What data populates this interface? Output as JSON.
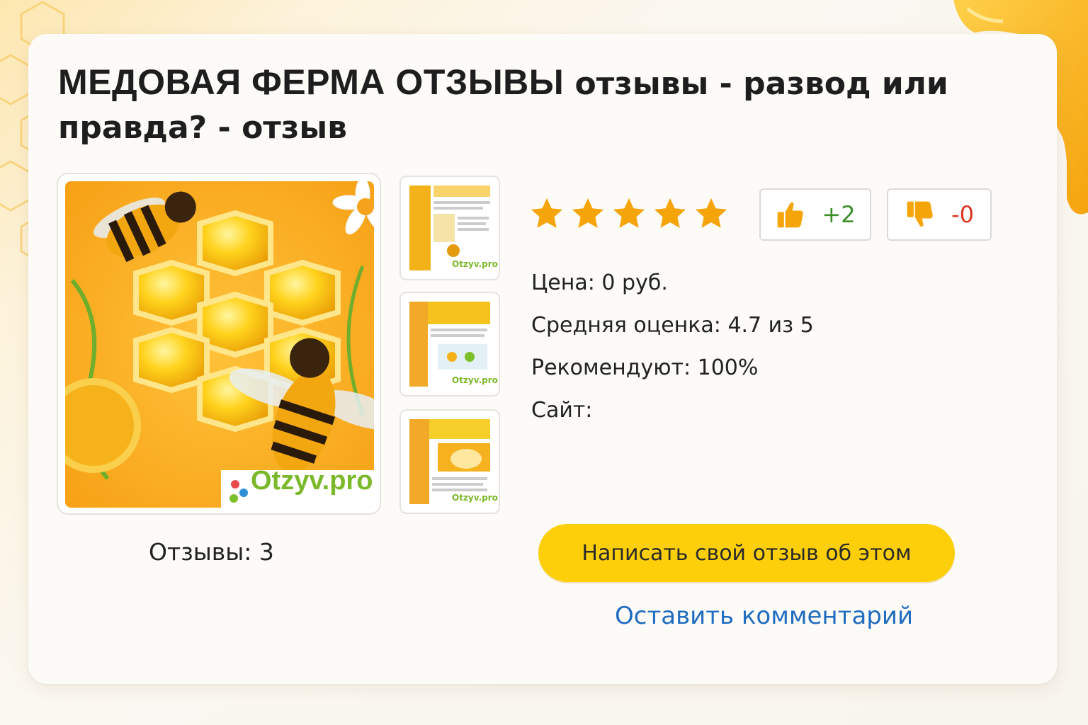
{
  "page": {
    "title_main": "МЕДОВАЯ ФЕРМА ОТЗЫВЫ",
    "title_rest": " отзывы - развод или правда? - отзыв"
  },
  "gallery": {
    "main_image_watermark": "Otzyv.pro",
    "thumbnails": [
      {
        "watermark": "Otzyv.pro"
      },
      {
        "watermark": "Otzyv.pro"
      },
      {
        "watermark": "Otzyv.pro"
      }
    ],
    "reviews_count_label": "Отзывы: 3"
  },
  "rating": {
    "stars": 5,
    "star_color": "#f5a50a",
    "likes_label": "+2",
    "dislikes_label": "-0"
  },
  "info": {
    "price_label": "Цена:",
    "price_value": "0 руб.",
    "avg_label": "Средняя оценка:",
    "avg_value": "4.7 из 5",
    "recommend_label": "Рекомендуют:",
    "recommend_value": "100%",
    "site_label": "Сайт:",
    "site_value": ""
  },
  "actions": {
    "write_review_label": "Написать свой отзыв об этом",
    "comment_link_label": "Оставить комментарий"
  },
  "colors": {
    "accent": "#fdcf0a",
    "link": "#1f6cc0",
    "like": "#3e8f2c",
    "dislike": "#d8361f"
  }
}
